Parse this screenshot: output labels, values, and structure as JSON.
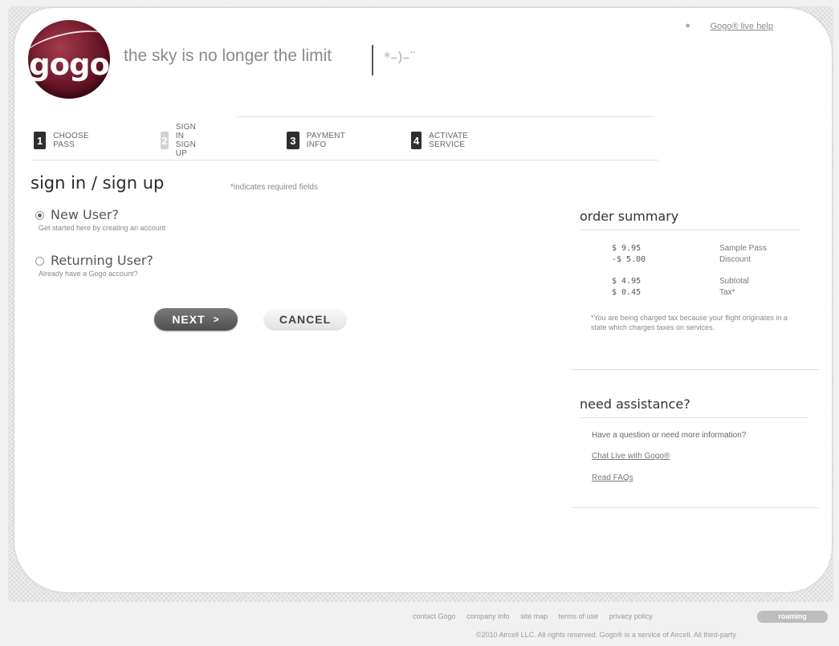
{
  "header": {
    "help_link": "Gogo® live help",
    "logo_text": "gogo",
    "tagline": "the sky is no longer the limit",
    "tag_symbol": "*–)–¨"
  },
  "steps": [
    {
      "num": "1",
      "label": "CHOOSE PASS"
    },
    {
      "num": "2",
      "label": "SIGN IN SIGN UP"
    },
    {
      "num": "3",
      "label": "PAYMENT INFO"
    },
    {
      "num": "4",
      "label": "ACTIVATE SERVICE"
    }
  ],
  "form": {
    "title": "sign in / sign up",
    "required_note": "*indicates required fields",
    "options": [
      {
        "title": "New User?",
        "sub": "Get started here by creating an account",
        "selected": true
      },
      {
        "title": "Returning User?",
        "sub": "Already have a Gogo account?",
        "selected": false
      }
    ],
    "next_label": "NEXT",
    "next_chevron": ">",
    "cancel_label": "CANCEL"
  },
  "order_summary": {
    "title": "order summary",
    "lines": [
      {
        "amount": "$ 9.95",
        "label": "Sample Pass"
      },
      {
        "amount": "-$ 5.00",
        "label": "Discount"
      },
      {
        "amount": "$ 4.95",
        "label": "Subtotal"
      },
      {
        "amount": "$ 0.45",
        "label": "Tax*"
      }
    ],
    "tax_note": "*You are being charged tax because your flight originates in a state which charges taxes on services."
  },
  "assistance": {
    "title": "need assistance?",
    "question": "Have a question or need more information?",
    "chat_link": "Chat Live with Gogo®",
    "faq_link": "Read FAQs"
  },
  "footer": {
    "links": [
      "contact Gogo",
      "company info",
      "site map",
      "terms of use",
      "privacy policy"
    ],
    "roaming_label": "roaming",
    "copyright": "©2010 Aircell LLC. All rights reserved. Gogo® is a service of Aircell. All third-party"
  }
}
